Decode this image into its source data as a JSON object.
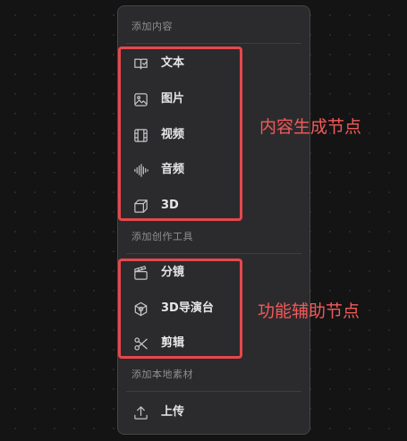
{
  "sections": [
    {
      "title": "添加内容",
      "items": [
        {
          "label": "文本",
          "icon": "text-icon"
        },
        {
          "label": "图片",
          "icon": "image-icon"
        },
        {
          "label": "视频",
          "icon": "video-icon"
        },
        {
          "label": "音频",
          "icon": "audio-icon"
        },
        {
          "label": "3D",
          "icon": "cube-icon"
        }
      ]
    },
    {
      "title": "添加创作工具",
      "items": [
        {
          "label": "分镜",
          "icon": "clapperboard-icon"
        },
        {
          "label": "3D导演台",
          "icon": "3d-stage-icon"
        },
        {
          "label": "剪辑",
          "icon": "scissors-icon"
        }
      ]
    },
    {
      "title": "添加本地素材",
      "items": [
        {
          "label": "上传",
          "icon": "upload-icon"
        }
      ]
    }
  ],
  "annotations": {
    "content_nodes": "内容生成节点",
    "tool_nodes": "功能辅助节点"
  },
  "colors": {
    "background": "#141414",
    "menu_bg": "#2b2b2d",
    "highlight": "#e5484d",
    "annotation_text": "#f25a5a"
  }
}
